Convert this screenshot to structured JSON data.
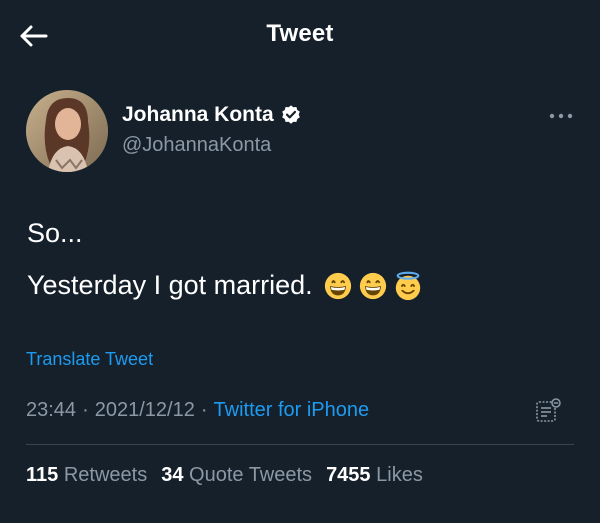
{
  "header": {
    "title": "Tweet",
    "back_icon": "arrow-left-icon"
  },
  "author": {
    "name": "Johanna Konta",
    "handle": "@JohannaKonta",
    "verified_icon": "verified-badge-icon"
  },
  "tweet": {
    "line1": "So...",
    "line2": "Yesterday I got married.",
    "emojis": [
      "grinning-face-emoji",
      "grinning-face-emoji",
      "smiling-face-with-halo-emoji"
    ]
  },
  "translate_label": "Translate Tweet",
  "meta": {
    "time": "23:44",
    "separator": "·",
    "date": "2021/12/12",
    "source": "Twitter for iPhone"
  },
  "stats": {
    "retweets_count": "115",
    "retweets_label": "Retweets",
    "quotes_count": "34",
    "quotes_label": "Quote Tweets",
    "likes_count": "7455",
    "likes_label": "Likes"
  },
  "colors": {
    "background": "#15202b",
    "text": "#ffffff",
    "secondary": "#8b98a5",
    "accent": "#1d9bf0",
    "divider": "#38444d"
  }
}
